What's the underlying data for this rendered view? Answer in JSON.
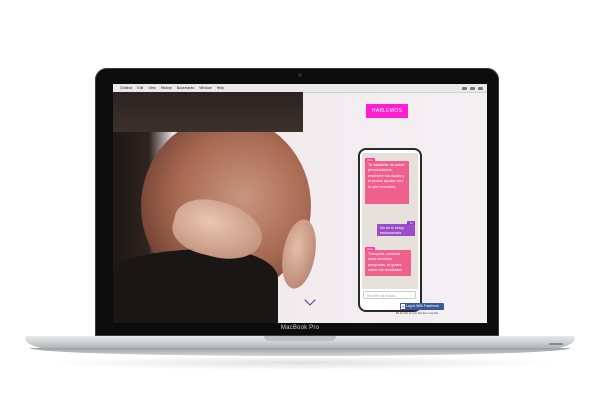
{
  "device": {
    "brand_label": "MacBook Pro"
  },
  "menubar": {
    "items": [
      "Chatbot",
      "Edit",
      "View",
      "History",
      "Bookmarks",
      "Window",
      "Help"
    ],
    "apple_icon": "apple-icon"
  },
  "site": {
    "cta_label": "HABLEMOS",
    "scroll_icon": "chevron-down-icon"
  },
  "chat": {
    "messages": [
      {
        "sender": "Zina",
        "text": "Tu asistente de salud personalizada, resolveré tus dudas y te puedo ayudar con lo que necesites"
      },
      {
        "sender": "Tú",
        "text": "No se si estoy embarazada"
      },
      {
        "sender": "Zina",
        "text": "Tranquila, contesta unas sencillas preguntas, te guiaré sobre tus resultados"
      }
    ],
    "input_placeholder": "Escribe tus dudas...",
    "facebook_button_label": "Log in With Facebook",
    "facebook_note": "Be the first of your friends to use this"
  },
  "colors": {
    "cta": "#ff1fd0",
    "bot_bubble": "#f0608f",
    "user_bubble": "#9a4ec8",
    "facebook": "#3b5998"
  }
}
